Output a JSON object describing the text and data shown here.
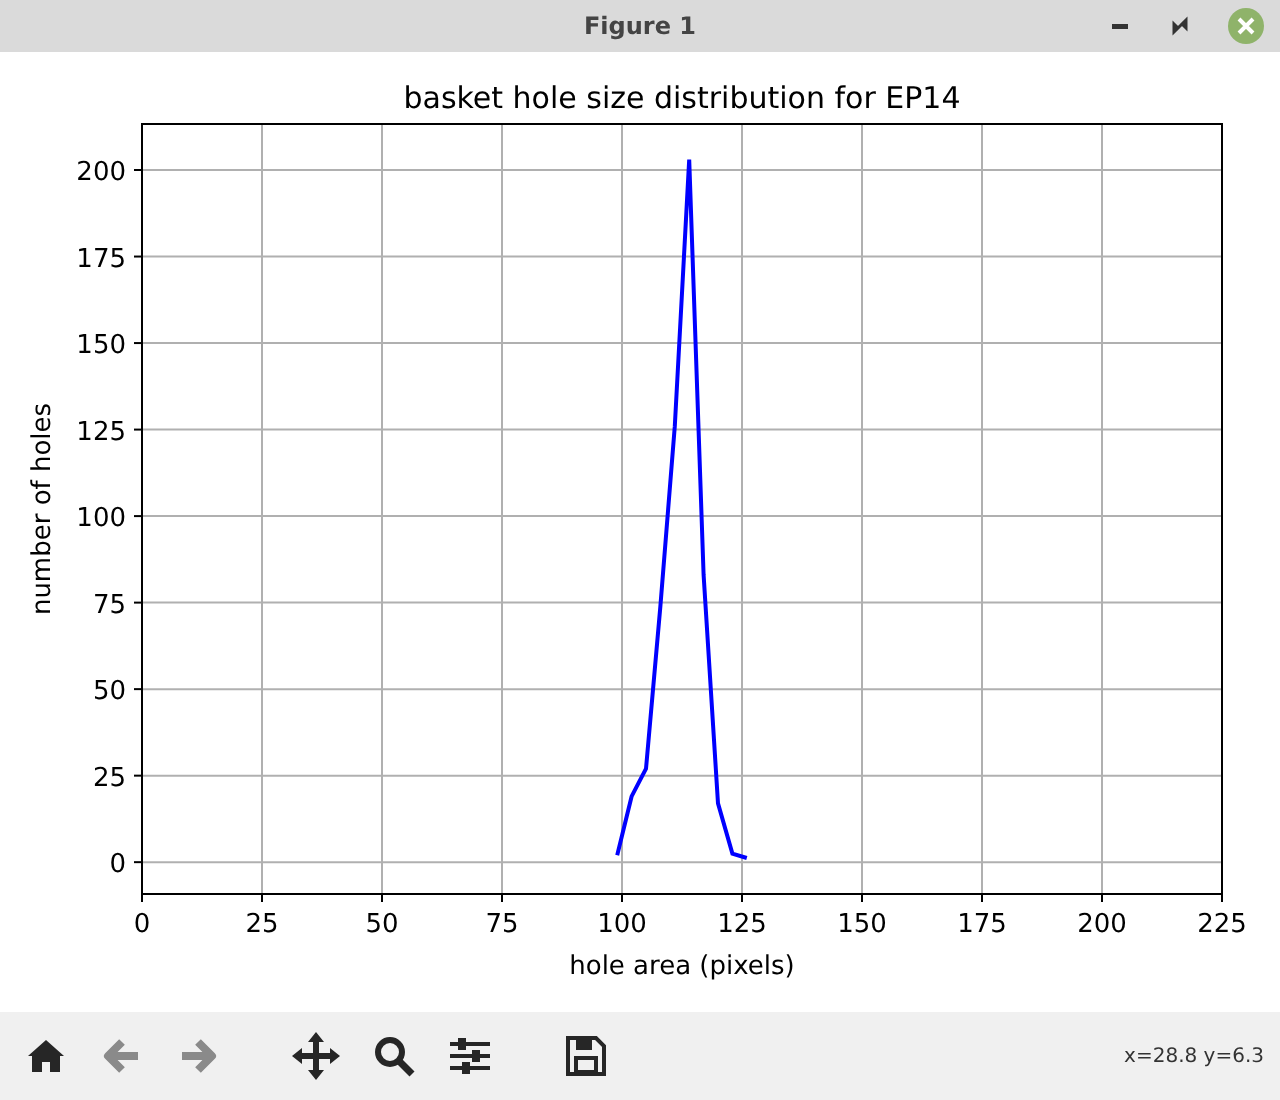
{
  "window": {
    "title": "Figure 1"
  },
  "figure": {
    "chart_data": {
      "type": "line",
      "title": "basket hole size distribution for EP14",
      "xlabel": "hole area (pixels)",
      "ylabel": "number of holes",
      "x": [
        99,
        102,
        105,
        108,
        111,
        114,
        117,
        120,
        123,
        126
      ],
      "series": [
        {
          "color": "#0000ff",
          "values": [
            2,
            19,
            27,
            74,
            126,
            203,
            83,
            17,
            2.5,
            1.2
          ]
        }
      ],
      "xlim": [
        0,
        225
      ],
      "ylim": [
        -9.2,
        213.3
      ],
      "xticks": [
        0,
        25,
        50,
        75,
        100,
        125,
        150,
        175,
        200,
        225
      ],
      "yticks": [
        0,
        25,
        50,
        75,
        100,
        125,
        150,
        175,
        200
      ],
      "grid": true
    }
  },
  "toolbar": {
    "buttons": [
      {
        "kind": "home",
        "disabled": false
      },
      {
        "kind": "back",
        "disabled": true
      },
      {
        "kind": "forward",
        "disabled": true
      },
      {
        "kind": "pan",
        "disabled": false
      },
      {
        "kind": "zoom",
        "disabled": false
      },
      {
        "kind": "configure",
        "disabled": false
      },
      {
        "kind": "save",
        "disabled": false
      }
    ],
    "coordinates": "x=28.8 y=6.3"
  }
}
